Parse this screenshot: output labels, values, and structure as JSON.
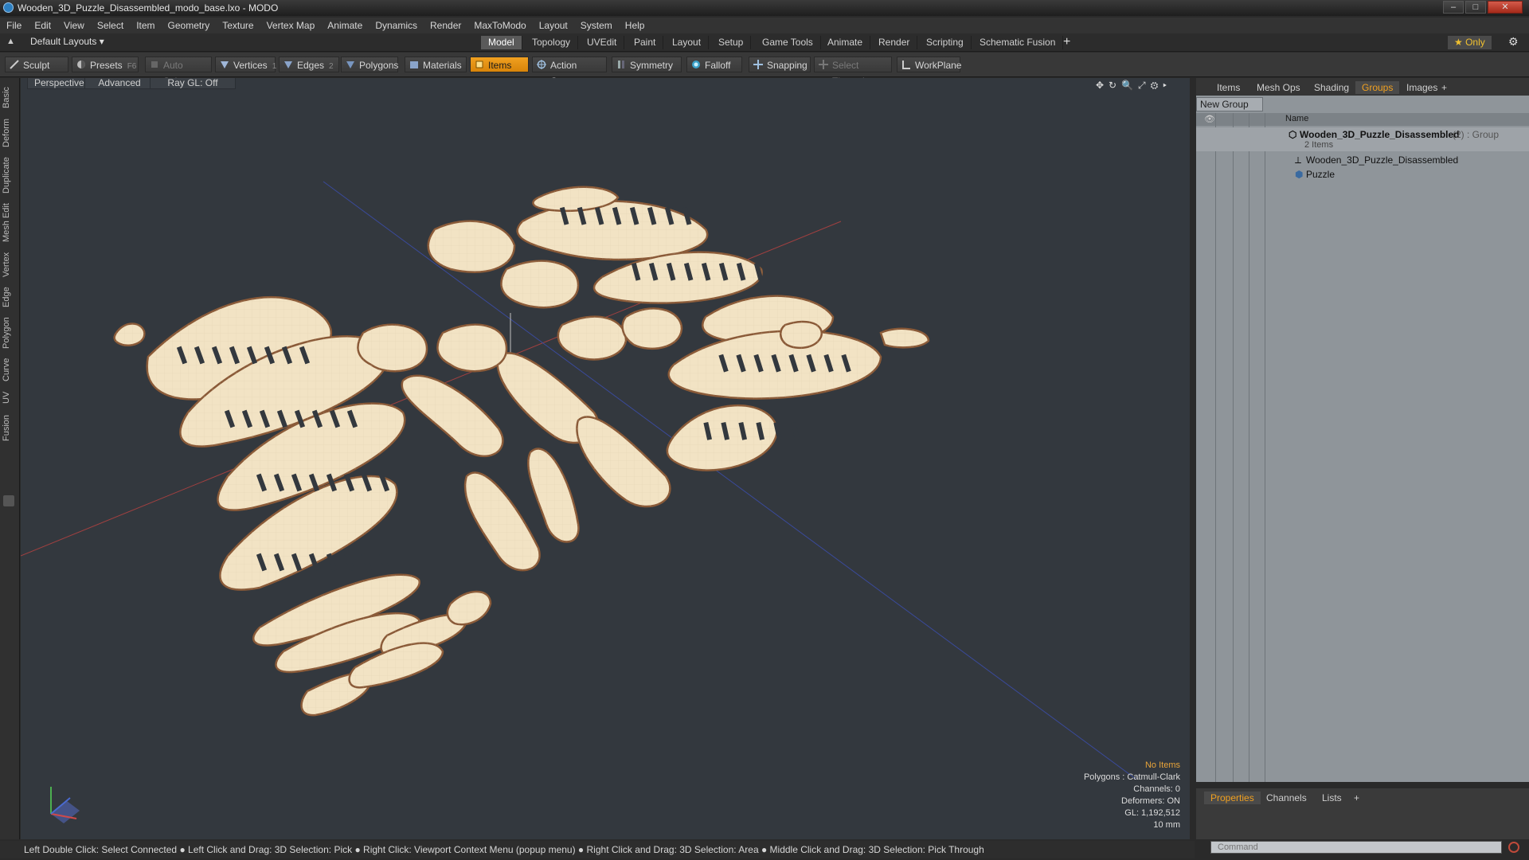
{
  "window": {
    "title": "Wooden_3D_Puzzle_Disassembled_modo_base.lxo - MODO"
  },
  "menu": [
    "File",
    "Edit",
    "View",
    "Select",
    "Item",
    "Geometry",
    "Texture",
    "Vertex Map",
    "Animate",
    "Dynamics",
    "Render",
    "MaxToModo",
    "Layout",
    "System",
    "Help"
  ],
  "layouts": {
    "selector": "Default Layouts ▾",
    "tabs": [
      "Model",
      "Topology",
      "UVEdit",
      "Paint",
      "Layout",
      "Setup",
      "Game Tools",
      "Animate",
      "Render",
      "Scripting",
      "Schematic Fusion"
    ],
    "active": "Model",
    "add": "+",
    "only_label": "★ Only"
  },
  "toolbar": {
    "sculpt": "Sculpt",
    "presets": "Presets",
    "presets_key": "F6",
    "auto_select": "Auto Select",
    "vertices": "Vertices",
    "vertices_key": "1",
    "edges": "Edges",
    "edges_key": "2",
    "polygons": "Polygons",
    "materials": "Materials",
    "items": "Items",
    "action_center": "Action Center",
    "symmetry": "Symmetry",
    "falloff": "Falloff",
    "snapping": "Snapping",
    "select_through": "Select Through",
    "workplane": "WorkPlane"
  },
  "left_tabs": [
    "Basic",
    "Deform",
    "Duplicate",
    "Mesh Edit",
    "Vertex",
    "Edge",
    "Polygon",
    "Curve",
    "UV",
    "Fusion"
  ],
  "viewport": {
    "view_label": "Perspective",
    "shading_label": "Advanced",
    "raygl_label": "Ray GL: Off",
    "info": {
      "no_items": "No Items",
      "polygons": "Polygons : Catmull-Clark",
      "channels": "Channels: 0",
      "deformers": "Deformers: ON",
      "gl": "GL: 1,192,512",
      "scale": "10 mm"
    }
  },
  "right_panel": {
    "tabs": [
      "Items",
      "Mesh Ops",
      "Shading",
      "Groups",
      "Images"
    ],
    "active_tab": "Groups",
    "add": "+",
    "new_group": "New Group",
    "name_header": "Name",
    "group_name": "Wooden_3D_Puzzle_Disassembled",
    "group_suffix": "(2) : Group",
    "item_count": "2 Items",
    "children": [
      "Wooden_3D_Puzzle_Disassembled",
      "Puzzle"
    ],
    "bottom_tabs": [
      "Properties",
      "Channels",
      "Lists"
    ],
    "bottom_active": "Properties",
    "bottom_add": "+",
    "command_placeholder": "Command"
  },
  "status": "Left Double Click: Select Connected ● Left Click and Drag: 3D Selection: Pick ● Right Click: Viewport Context Menu (popup menu) ● Right Click and Drag: 3D Selection: Area ● Middle Click and Drag: 3D Selection: Pick Through",
  "colors": {
    "accent": "#f0a020",
    "wood": "#f2e3c4",
    "wood_edge": "#8a5a38",
    "viewport_bg": "#33383e"
  }
}
